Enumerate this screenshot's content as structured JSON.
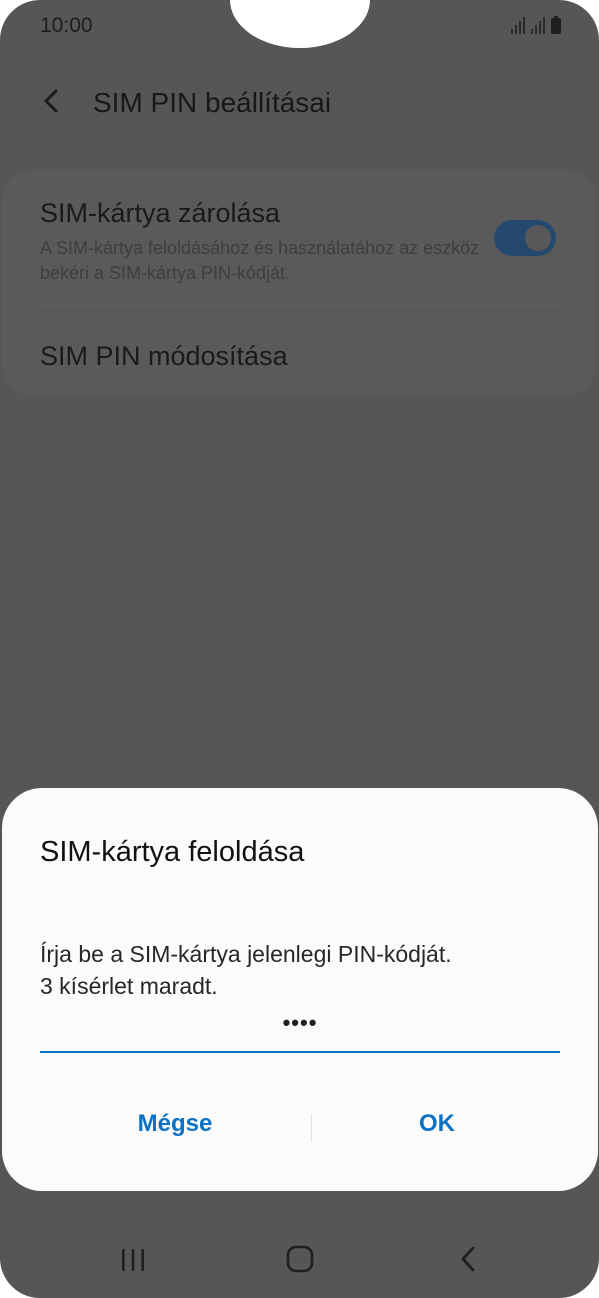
{
  "status_bar": {
    "time": "10:00",
    "icons": [
      "signal-icon",
      "signal-icon",
      "battery-icon"
    ]
  },
  "header": {
    "back_icon": "chevron-left-icon",
    "title": "SIM PIN beállításai"
  },
  "settings": {
    "lock": {
      "title": "SIM-kártya zárolása",
      "description": "A SIM-kártya feloldásához és használatához az eszköz bekéri a SIM-kártya PIN-kódját.",
      "toggle_on": true
    },
    "change_pin": {
      "title": "SIM PIN módosítása"
    }
  },
  "dialog": {
    "title": "SIM-kártya feloldása",
    "message_line1": "Írja be a SIM-kártya jelenlegi PIN-kódját.",
    "message_line2": "3 kísérlet maradt.",
    "pin_value": "••••",
    "cancel_label": "Mégse",
    "ok_label": "OK"
  },
  "nav_bar": {
    "icons": [
      "recents-icon",
      "home-icon",
      "back-icon"
    ]
  },
  "colors": {
    "accent": "#0b72c6",
    "toggle": "#25496e",
    "scrim": "#565656"
  }
}
